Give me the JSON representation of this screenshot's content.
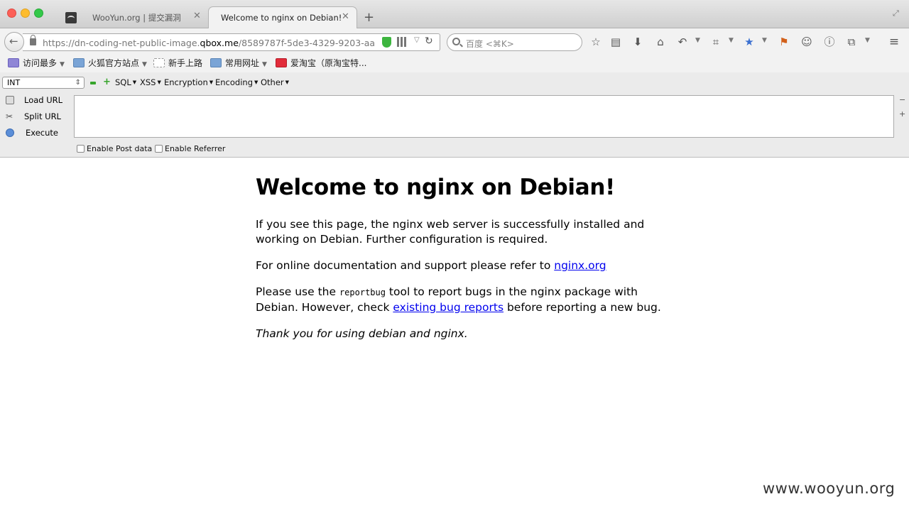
{
  "tabs": [
    {
      "title": "WooYun.org | 提交漏洞"
    },
    {
      "title": "Welcome to nginx on Debian!"
    }
  ],
  "tab_close_glyph": "✕",
  "new_tab_glyph": "+",
  "url": {
    "prefix": "https://dn-coding-net-public-image.",
    "host": "qbox.me",
    "suffix": "/8589787f-5de3-4329-9203-aa"
  },
  "search": {
    "placeholder": "百度 <⌘K>"
  },
  "bookmarks": [
    {
      "label": "访问最多"
    },
    {
      "label": "火狐官方站点"
    },
    {
      "label": "新手上路"
    },
    {
      "label": "常用网址"
    },
    {
      "label": "爱淘宝（原淘宝特..."
    }
  ],
  "hackbar": {
    "select_value": "INT",
    "menus": [
      "SQL",
      "XSS",
      "Encryption",
      "Encoding",
      "Other"
    ],
    "load_url": "Load URL",
    "split_url": "Split URL",
    "execute": "Execute",
    "enable_post": "Enable Post data",
    "enable_referrer": "Enable Referrer",
    "side_minus": "−",
    "side_plus": "+"
  },
  "page": {
    "heading": "Welcome to nginx on Debian!",
    "p1": "If you see this page, the nginx web server is successfully installed and working on Debian. Further configuration is required.",
    "p2_text": "For online documentation and support please refer to ",
    "p2_link": "nginx.org",
    "p3_a": "Please use the ",
    "p3_code": "reportbug",
    "p3_b": " tool to report bugs in the nginx package with Debian. However, check ",
    "p3_link": "existing bug reports",
    "p3_c": " before reporting a new bug.",
    "p4": "Thank you for using debian and nginx."
  },
  "watermark": "www.wooyun.org",
  "icons": {
    "toolbar": [
      "bookmark-star-icon",
      "reading-list-icon",
      "download-icon",
      "home-icon",
      "undo-icon",
      "crop-icon",
      "addon-star-icon",
      "flag-icon",
      "chat-icon",
      "info-icon",
      "share-icon",
      "hamburger-menu-icon"
    ]
  }
}
